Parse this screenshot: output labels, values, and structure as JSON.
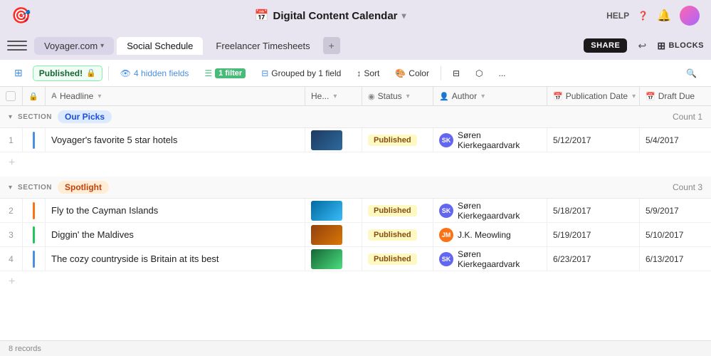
{
  "app": {
    "logo_icon": "🎯",
    "title": "Digital Content Calendar",
    "title_icon": "📅",
    "dropdown_arrow": "▾"
  },
  "top_bar": {
    "help": "HELP",
    "help_icon": "❓",
    "bell_icon": "🔔"
  },
  "tabs": [
    {
      "id": "workspace",
      "label": "Voyager.com",
      "active": false,
      "is_workspace": true
    },
    {
      "id": "social",
      "label": "Social Schedule",
      "active": true
    },
    {
      "id": "freelancer",
      "label": "Freelancer Timesheets",
      "active": false
    }
  ],
  "tab_bar_right": {
    "share": "SHARE",
    "history_icon": "↩",
    "blocks": "BLOCKS"
  },
  "toolbar": {
    "view_icon": "⊞",
    "published_label": "Published!",
    "lock_icon": "🔒",
    "hidden_fields": "4 hidden fields",
    "filter": "1 filter",
    "grouped": "Grouped by 1 field",
    "sort": "Sort",
    "color": "Color",
    "expand_icon": "⊟",
    "link_icon": "⬡",
    "more": "...",
    "search_icon": "🔍"
  },
  "columns": [
    {
      "id": "check",
      "label": ""
    },
    {
      "id": "lock",
      "label": ""
    },
    {
      "id": "headline",
      "label": "Headline",
      "icon": "A",
      "type": "text"
    },
    {
      "id": "he",
      "label": "He...",
      "type": "image"
    },
    {
      "id": "status",
      "label": "Status",
      "icon": "◉",
      "type": "status"
    },
    {
      "id": "author",
      "label": "Author",
      "icon": "👤",
      "type": "person"
    },
    {
      "id": "pub_date",
      "label": "Publication Date",
      "icon": "📅",
      "type": "date"
    },
    {
      "id": "draft_due",
      "label": "Draft Due",
      "icon": "📅",
      "type": "date"
    }
  ],
  "sections": [
    {
      "id": "our-picks",
      "label": "SECTION",
      "name": "Our Picks",
      "tag_class": "tag-blue",
      "count_label": "Count",
      "count": 1,
      "rows": [
        {
          "num": "1",
          "color": "bar-blue",
          "headline": "Voyager's favorite 5 star hotels",
          "thumb": "thumb-blue",
          "status": "Published",
          "status_class": "status-published",
          "author": "Søren Kierkegaardvark",
          "author_class": "av1",
          "author_initials": "SK",
          "pub_date": "5/12/2017",
          "draft_due": "5/4/2017"
        }
      ]
    },
    {
      "id": "spotlight",
      "label": "SECTION",
      "name": "Spotlight",
      "tag_class": "tag-orange",
      "count_label": "Count",
      "count": 3,
      "rows": [
        {
          "num": "2",
          "color": "bar-orange",
          "headline": "Fly to the Cayman Islands",
          "thumb": "thumb-ocean",
          "status": "Published",
          "status_class": "status-published",
          "author": "Søren Kierkegaardvark",
          "author_class": "av1",
          "author_initials": "SK",
          "pub_date": "5/18/2017",
          "draft_due": "5/9/2017"
        },
        {
          "num": "3",
          "color": "bar-green",
          "headline": "Diggin' the Maldives",
          "thumb": "thumb-sand",
          "status": "Published",
          "status_class": "status-published",
          "author": "J.K. Meowling",
          "author_class": "av-cat",
          "author_initials": "JM",
          "pub_date": "5/19/2017",
          "draft_due": "5/10/2017"
        },
        {
          "num": "4",
          "color": "bar-blue",
          "headline": "The cozy countryside is Britain at its best",
          "thumb": "thumb-green",
          "status": "Published",
          "status_class": "status-published",
          "author": "Søren Kierkegaardvark",
          "author_class": "av1",
          "author_initials": "SK",
          "pub_date": "6/23/2017",
          "draft_due": "6/13/2017"
        }
      ]
    }
  ],
  "status_bar": {
    "records": "8 records"
  }
}
